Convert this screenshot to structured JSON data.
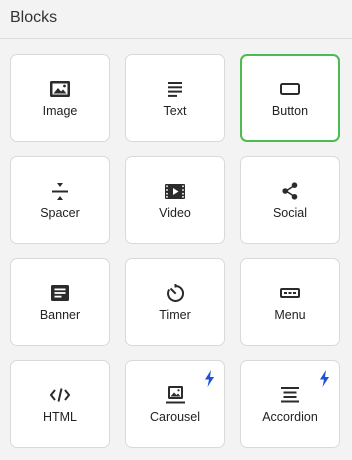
{
  "panel": {
    "title": "Blocks"
  },
  "accent": {
    "selected_border": "#4dbb4d",
    "bolt": "#1e4fd8"
  },
  "blocks": [
    {
      "label": "Image",
      "icon": "image-icon",
      "selected": false,
      "premium": false
    },
    {
      "label": "Text",
      "icon": "text-icon",
      "selected": false,
      "premium": false
    },
    {
      "label": "Button",
      "icon": "button-icon",
      "selected": true,
      "premium": false
    },
    {
      "label": "Spacer",
      "icon": "spacer-icon",
      "selected": false,
      "premium": false
    },
    {
      "label": "Video",
      "icon": "video-icon",
      "selected": false,
      "premium": false
    },
    {
      "label": "Social",
      "icon": "share-icon",
      "selected": false,
      "premium": false
    },
    {
      "label": "Banner",
      "icon": "banner-icon",
      "selected": false,
      "premium": false
    },
    {
      "label": "Timer",
      "icon": "timer-icon",
      "selected": false,
      "premium": false
    },
    {
      "label": "Menu",
      "icon": "menu-icon",
      "selected": false,
      "premium": false
    },
    {
      "label": "HTML",
      "icon": "code-icon",
      "selected": false,
      "premium": false
    },
    {
      "label": "Carousel",
      "icon": "carousel-icon",
      "selected": false,
      "premium": true
    },
    {
      "label": "Accordion",
      "icon": "accordion-icon",
      "selected": false,
      "premium": true
    }
  ]
}
